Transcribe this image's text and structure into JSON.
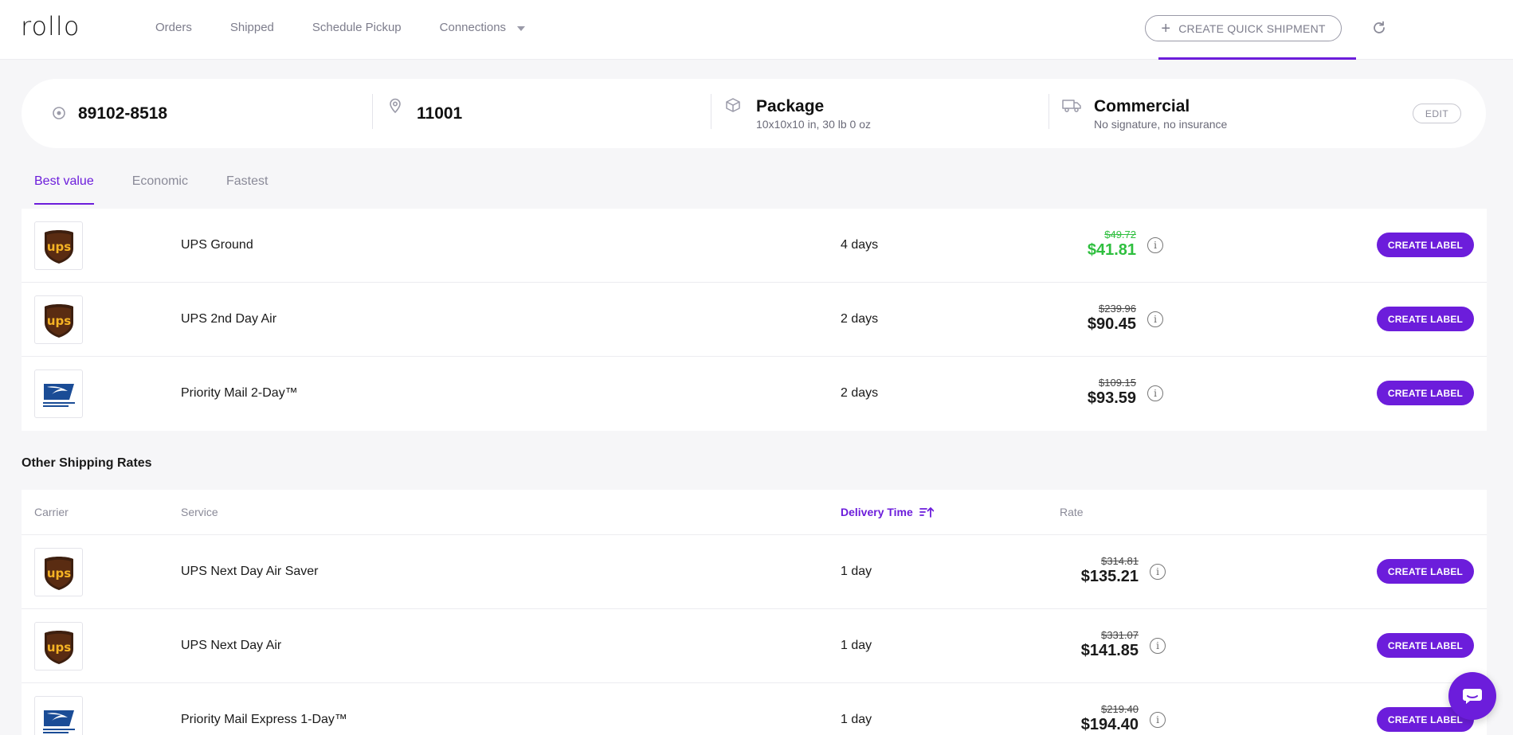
{
  "header": {
    "logo": "rollo",
    "nav": [
      {
        "label": "Orders"
      },
      {
        "label": "Shipped"
      },
      {
        "label": "Schedule Pickup"
      },
      {
        "label": "Connections"
      }
    ],
    "quick_shipment_label": "CREATE QUICK SHIPMENT",
    "accent_color": "#6c1ddb"
  },
  "summary": {
    "from_zip": "89102-8518",
    "to_zip": "11001",
    "package_title": "Package",
    "package_detail": "10x10x10 in, 30 lb 0 oz",
    "type_title": "Commercial",
    "type_detail": "No signature, no insurance",
    "edit_label": "EDIT"
  },
  "tabs": [
    {
      "label": "Best value",
      "active": true
    },
    {
      "label": "Economic",
      "active": false
    },
    {
      "label": "Fastest",
      "active": false
    }
  ],
  "best_rates": [
    {
      "carrier": "ups",
      "service": "UPS Ground",
      "delivery": "4 days",
      "old_price": "$49.72",
      "price": "$41.81",
      "highlight": true,
      "action": "CREATE LABEL"
    },
    {
      "carrier": "ups",
      "service": "UPS 2nd Day Air",
      "delivery": "2 days",
      "old_price": "$239.96",
      "price": "$90.45",
      "highlight": false,
      "action": "CREATE LABEL"
    },
    {
      "carrier": "usps",
      "service": "Priority Mail 2-Day™",
      "delivery": "2 days",
      "old_price": "$109.15",
      "price": "$93.59",
      "highlight": false,
      "action": "CREATE LABEL"
    }
  ],
  "other": {
    "title": "Other Shipping Rates",
    "columns": {
      "carrier": "Carrier",
      "service": "Service",
      "delivery": "Delivery Time",
      "rate": "Rate"
    },
    "rows": [
      {
        "carrier": "ups",
        "service": "UPS Next Day Air Saver",
        "delivery": "1 day",
        "old_price": "$314.81",
        "price": "$135.21",
        "action": "CREATE LABEL"
      },
      {
        "carrier": "ups",
        "service": "UPS Next Day Air",
        "delivery": "1 day",
        "old_price": "$331.07",
        "price": "$141.85",
        "action": "CREATE LABEL"
      },
      {
        "carrier": "usps",
        "service": "Priority Mail Express 1-Day™",
        "delivery": "1 day",
        "old_price": "$219.40",
        "price": "$194.40",
        "action": "CREATE LABEL"
      }
    ]
  },
  "icons": {
    "refresh": "refresh-icon",
    "origin": "origin-target-icon",
    "destination": "location-pin-icon",
    "package": "box-icon",
    "delivery_type": "truck-icon",
    "info": "info-icon",
    "sort": "sort-ascending-icon",
    "chat": "chat-icon"
  }
}
